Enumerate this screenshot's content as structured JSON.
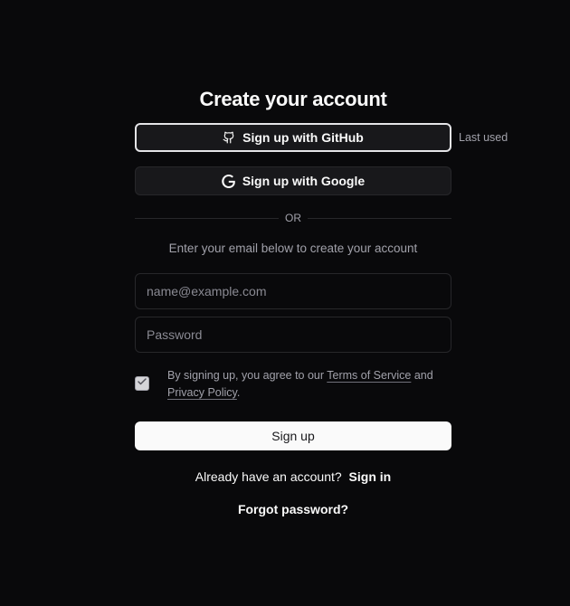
{
  "page": {
    "title": "Create your account"
  },
  "oauth": {
    "github_label": "Sign up with GitHub",
    "github_icon": "github-icon",
    "google_label": "Sign up with Google",
    "google_icon": "google-icon",
    "last_used": "Last used"
  },
  "divider": {
    "text": "OR"
  },
  "form": {
    "subtitle": "Enter your email below to create your account",
    "email_placeholder": "name@example.com",
    "email_value": "",
    "password_placeholder": "Password",
    "password_value": "",
    "agree_checked": true,
    "terms_prefix": "By signing up, you agree to our",
    "terms_link": "Terms of Service",
    "terms_and": "and",
    "privacy_link": "Privacy Policy",
    "terms_suffix": ".",
    "submit_label": "Sign up"
  },
  "footer": {
    "signin_prompt": "Already have an account?",
    "signin_link": "Sign in",
    "forgot_link": "Forgot password?"
  },
  "colors": {
    "background": "#09090b",
    "card_border": "#27272a",
    "primary_button": "#fafafa",
    "muted_text": "#a1a1aa"
  }
}
